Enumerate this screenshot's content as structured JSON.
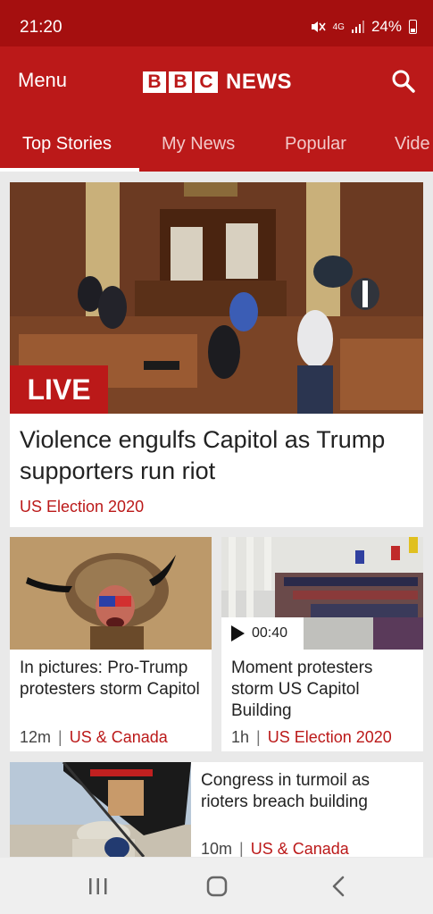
{
  "status": {
    "time": "21:20",
    "network": "4G",
    "battery": "24%"
  },
  "header": {
    "menu_label": "Menu",
    "logo_letters": [
      "B",
      "B",
      "C"
    ],
    "logo_word": "NEWS"
  },
  "tabs": [
    {
      "label": "Top Stories",
      "active": true
    },
    {
      "label": "My News",
      "active": false
    },
    {
      "label": "Popular",
      "active": false
    },
    {
      "label": "Vide",
      "active": false
    }
  ],
  "hero": {
    "badge": "LIVE",
    "title": "Violence engulfs Capitol as Trump supporters run riot",
    "topic": "US Election 2020"
  },
  "stories": [
    {
      "title": "In pictures: Pro-Trump protesters storm Capitol",
      "time": "12m",
      "topic": "US & Canada"
    },
    {
      "title": "Moment protesters storm US Capitol Building",
      "time": "1h",
      "topic": "US Election 2020",
      "video_duration": "00:40"
    }
  ],
  "wide_story": {
    "title": "Congress in turmoil as rioters breach building",
    "time": "10m",
    "topic": "US & Canada"
  },
  "colors": {
    "brand_red": "#bb1919",
    "status_red": "#a50f0f"
  },
  "icons": [
    "search-icon",
    "play-icon",
    "recent-apps-icon",
    "home-icon",
    "back-icon"
  ]
}
